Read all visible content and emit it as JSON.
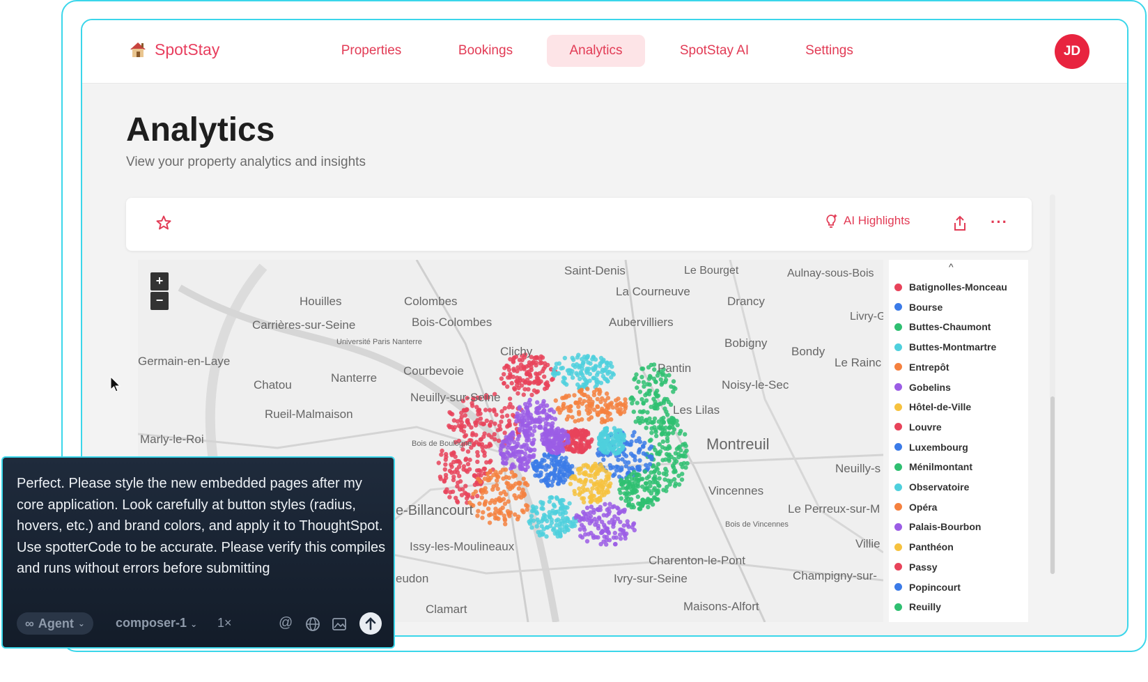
{
  "brand": {
    "name": "SpotStay"
  },
  "nav": {
    "items": [
      {
        "label": "Properties"
      },
      {
        "label": "Bookings"
      },
      {
        "label": "Analytics"
      },
      {
        "label": "SpotStay AI"
      },
      {
        "label": "Settings"
      }
    ],
    "active": "Analytics"
  },
  "user": {
    "initials": "JD"
  },
  "page": {
    "title": "Analytics",
    "subtitle": "View your property analytics and insights"
  },
  "toolbar": {
    "ai_highlights_label": "AI Highlights",
    "more_label": "···"
  },
  "map": {
    "zoom_in": "+",
    "zoom_out": "−",
    "place_labels": [
      "Saint-Denis",
      "Le Bourget",
      "Aulnay-sous-Bois",
      "La Courneuve",
      "Drancy",
      "Houilles",
      "Colombes",
      "Carrières-sur-Seine",
      "Bois-Colombes",
      "Aubervilliers",
      "Livry-G",
      "Université Paris Nanterre",
      "Germain-en-Laye",
      "Clichy",
      "Bobigny",
      "Bondy",
      "Le Rainc",
      "Chatou",
      "Nanterre",
      "Courbevoie",
      "Pantin",
      "Noisy-le-Sec",
      "Neuilly-sur-Seine",
      "Les Lilas",
      "Rueil-Malmaison",
      "Montreuil",
      "Marly-le-Roi",
      "Bois de Boulogne",
      "Neuilly-s",
      "Vincennes",
      "Le Perreux-sur-M",
      "e-Billancourt",
      "Bois de Vincennes",
      "Issy-les-Moulineaux",
      "Villie",
      "Charenton-le-Pont",
      "eudon",
      "Ivry-sur-Seine",
      "Champigny-sur-",
      "Clamart",
      "Maisons-Alfort"
    ]
  },
  "legend": {
    "caret": "^",
    "items": [
      {
        "label": "Batignolles-Monceau",
        "color": "#e8435a"
      },
      {
        "label": "Bourse",
        "color": "#3b7be8"
      },
      {
        "label": "Buttes-Chaumont",
        "color": "#2fbf71"
      },
      {
        "label": "Buttes-Montmartre",
        "color": "#4fd0dd"
      },
      {
        "label": "Entrepôt",
        "color": "#f5813f"
      },
      {
        "label": "Gobelins",
        "color": "#9b5de5"
      },
      {
        "label": "Hôtel-de-Ville",
        "color": "#f6c23e"
      },
      {
        "label": "Louvre",
        "color": "#e8435a"
      },
      {
        "label": "Luxembourg",
        "color": "#3b7be8"
      },
      {
        "label": "Ménilmontant",
        "color": "#2fbf71"
      },
      {
        "label": "Observatoire",
        "color": "#4fd0dd"
      },
      {
        "label": "Opéra",
        "color": "#f5813f"
      },
      {
        "label": "Palais-Bourbon",
        "color": "#9b5de5"
      },
      {
        "label": "Panthéon",
        "color": "#f6c23e"
      },
      {
        "label": "Passy",
        "color": "#e8435a"
      },
      {
        "label": "Popincourt",
        "color": "#3b7be8"
      },
      {
        "label": "Reuilly",
        "color": "#2fbf71"
      }
    ]
  },
  "prompt": {
    "text": "Perfect. Please style the new embedded pages after my core application. Look carefully at button styles (radius, hovers, etc.) and brand colors, and apply it to ThoughtSpot. Use spotterCode to be accurate. Please verify this compiles and runs without errors before submitting",
    "agent_label": "Agent",
    "model_label": "composer-1",
    "speed_label": "1×"
  },
  "colors": {
    "brand": "#e23b55",
    "accent_border": "#3ad6ea"
  }
}
